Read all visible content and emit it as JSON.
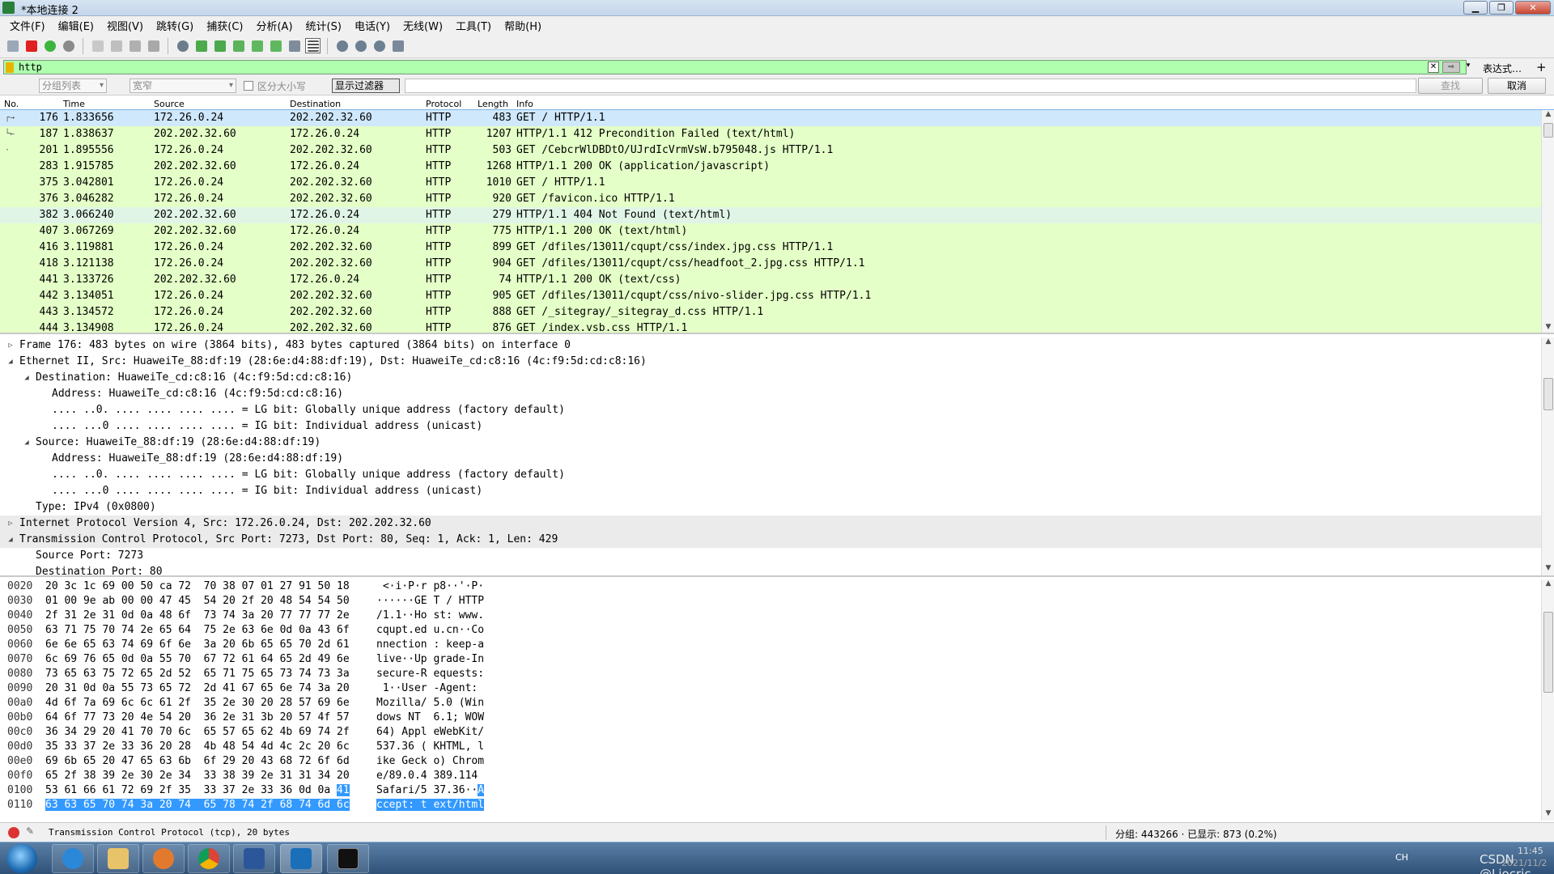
{
  "window": {
    "title": "*本地连接 2"
  },
  "menu": [
    "文件(F)",
    "编辑(E)",
    "视图(V)",
    "跳转(G)",
    "捕获(C)",
    "分析(A)",
    "统计(S)",
    "电话(Y)",
    "无线(W)",
    "工具(T)",
    "帮助(H)"
  ],
  "filter": {
    "value": "http",
    "expression_label": "表达式…",
    "clear_label": "✕",
    "plus_label": "+"
  },
  "find": {
    "packet_list_combo": "分组列表",
    "width_combo": "宽窄",
    "case_label": "区分大小写",
    "display_filter_btn": "显示过滤器",
    "find_btn": "查找",
    "cancel_btn": "取消"
  },
  "packet_list": {
    "columns": {
      "no": "No.",
      "time": "Time",
      "source": "Source",
      "destination": "Destination",
      "protocol": "Protocol",
      "length": "Length",
      "info": "Info"
    },
    "rows": [
      {
        "no": "176",
        "time": "1.833656",
        "src": "172.26.0.24",
        "dst": "202.202.32.60",
        "proto": "HTTP",
        "len": "483",
        "info": "GET / HTTP/1.1"
      },
      {
        "no": "187",
        "time": "1.838637",
        "src": "202.202.32.60",
        "dst": "172.26.0.24",
        "proto": "HTTP",
        "len": "1207",
        "info": "HTTP/1.1 412 Precondition Failed  (text/html)"
      },
      {
        "no": "201",
        "time": "1.895556",
        "src": "172.26.0.24",
        "dst": "202.202.32.60",
        "proto": "HTTP",
        "len": "503",
        "info": "GET /CebcrWlDBDtO/UJrdIcVrmVsW.b795048.js HTTP/1.1"
      },
      {
        "no": "283",
        "time": "1.915785",
        "src": "202.202.32.60",
        "dst": "172.26.0.24",
        "proto": "HTTP",
        "len": "1268",
        "info": "HTTP/1.1 200 OK  (application/javascript)"
      },
      {
        "no": "375",
        "time": "3.042801",
        "src": "172.26.0.24",
        "dst": "202.202.32.60",
        "proto": "HTTP",
        "len": "1010",
        "info": "GET / HTTP/1.1"
      },
      {
        "no": "376",
        "time": "3.046282",
        "src": "172.26.0.24",
        "dst": "202.202.32.60",
        "proto": "HTTP",
        "len": "920",
        "info": "GET /favicon.ico HTTP/1.1"
      },
      {
        "no": "382",
        "time": "3.066240",
        "src": "202.202.32.60",
        "dst": "172.26.0.24",
        "proto": "HTTP",
        "len": "279",
        "info": "HTTP/1.1 404 Not Found  (text/html)"
      },
      {
        "no": "407",
        "time": "3.067269",
        "src": "202.202.32.60",
        "dst": "172.26.0.24",
        "proto": "HTTP",
        "len": "775",
        "info": "HTTP/1.1 200 OK  (text/html)"
      },
      {
        "no": "416",
        "time": "3.119881",
        "src": "172.26.0.24",
        "dst": "202.202.32.60",
        "proto": "HTTP",
        "len": "899",
        "info": "GET /dfiles/13011/cqupt/css/index.jpg.css HTTP/1.1"
      },
      {
        "no": "418",
        "time": "3.121138",
        "src": "172.26.0.24",
        "dst": "202.202.32.60",
        "proto": "HTTP",
        "len": "904",
        "info": "GET /dfiles/13011/cqupt/css/headfoot_2.jpg.css HTTP/1.1"
      },
      {
        "no": "441",
        "time": "3.133726",
        "src": "202.202.32.60",
        "dst": "172.26.0.24",
        "proto": "HTTP",
        "len": "74",
        "info": "HTTP/1.1 200 OK  (text/css)"
      },
      {
        "no": "442",
        "time": "3.134051",
        "src": "172.26.0.24",
        "dst": "202.202.32.60",
        "proto": "HTTP",
        "len": "905",
        "info": "GET /dfiles/13011/cqupt/css/nivo-slider.jpg.css HTTP/1.1"
      },
      {
        "no": "443",
        "time": "3.134572",
        "src": "172.26.0.24",
        "dst": "202.202.32.60",
        "proto": "HTTP",
        "len": "888",
        "info": "GET /_sitegray/_sitegray_d.css HTTP/1.1"
      },
      {
        "no": "444",
        "time": "3.134908",
        "src": "172.26.0.24",
        "dst": "202.202.32.60",
        "proto": "HTTP",
        "len": "876",
        "info": "GET /index.vsb.css HTTP/1.1"
      }
    ]
  },
  "detail_tree": [
    {
      "toggle": "▷",
      "text": "Frame 176: 483 bytes on wire (3864 bits), 483 bytes captured (3864 bits) on interface 0"
    },
    {
      "toggle": "◢",
      "text": "Ethernet II, Src: HuaweiTe_88:df:19 (28:6e:d4:88:df:19), Dst: HuaweiTe_cd:c8:16 (4c:f9:5d:cd:c8:16)"
    },
    {
      "toggle": "◢",
      "text": "Destination: HuaweiTe_cd:c8:16 (4c:f9:5d:cd:c8:16)"
    },
    {
      "toggle": "",
      "text": "Address: HuaweiTe_cd:c8:16 (4c:f9:5d:cd:c8:16)"
    },
    {
      "toggle": "",
      "text": ".... ..0. .... .... .... .... = LG bit: Globally unique address (factory default)"
    },
    {
      "toggle": "",
      "text": ".... ...0 .... .... .... .... = IG bit: Individual address (unicast)"
    },
    {
      "toggle": "◢",
      "text": "Source: HuaweiTe_88:df:19 (28:6e:d4:88:df:19)"
    },
    {
      "toggle": "",
      "text": "Address: HuaweiTe_88:df:19 (28:6e:d4:88:df:19)"
    },
    {
      "toggle": "",
      "text": ".... ..0. .... .... .... .... = LG bit: Globally unique address (factory default)"
    },
    {
      "toggle": "",
      "text": ".... ...0 .... .... .... .... = IG bit: Individual address (unicast)"
    },
    {
      "toggle": "",
      "text": "Type: IPv4 (0x0800)"
    },
    {
      "toggle": "▷",
      "text": "Internet Protocol Version 4, Src: 172.26.0.24, Dst: 202.202.32.60"
    },
    {
      "toggle": "◢",
      "text": "Transmission Control Protocol, Src Port: 7273, Dst Port: 80, Seq: 1, Ack: 1, Len: 429"
    },
    {
      "toggle": "",
      "text": "Source Port: 7273"
    },
    {
      "toggle": "",
      "text": "Destination Port: 80"
    }
  ],
  "hex_dump": [
    {
      "off": "0020",
      "bytes": "20 3c 1c 69 00 50 ca 72  70 38 07 01 27 91 50 18",
      "sel_bytes": "",
      "ascii": " <·i·P·r p8··'·P·",
      "sel_ascii": ""
    },
    {
      "off": "0030",
      "bytes": "01 00 9e ab 00 00 47 45  54 20 2f 20 48 54 54 50",
      "sel_bytes": "",
      "ascii": "······GE T / HTTP",
      "sel_ascii": ""
    },
    {
      "off": "0040",
      "bytes": "2f 31 2e 31 0d 0a 48 6f  73 74 3a 20 77 77 77 2e",
      "sel_bytes": "",
      "ascii": "/1.1··Ho st: www.",
      "sel_ascii": ""
    },
    {
      "off": "0050",
      "bytes": "63 71 75 70 74 2e 65 64  75 2e 63 6e 0d 0a 43 6f",
      "sel_bytes": "",
      "ascii": "cqupt.ed u.cn··Co",
      "sel_ascii": ""
    },
    {
      "off": "0060",
      "bytes": "6e 6e 65 63 74 69 6f 6e  3a 20 6b 65 65 70 2d 61",
      "sel_bytes": "",
      "ascii": "nnection : keep-a",
      "sel_ascii": ""
    },
    {
      "off": "0070",
      "bytes": "6c 69 76 65 0d 0a 55 70  67 72 61 64 65 2d 49 6e",
      "sel_bytes": "",
      "ascii": "live··Up grade-In",
      "sel_ascii": ""
    },
    {
      "off": "0080",
      "bytes": "73 65 63 75 72 65 2d 52  65 71 75 65 73 74 73 3a",
      "sel_bytes": "",
      "ascii": "secure-R equests:",
      "sel_ascii": ""
    },
    {
      "off": "0090",
      "bytes": "20 31 0d 0a 55 73 65 72  2d 41 67 65 6e 74 3a 20",
      "sel_bytes": "",
      "ascii": " 1··User -Agent: ",
      "sel_ascii": ""
    },
    {
      "off": "00a0",
      "bytes": "4d 6f 7a 69 6c 6c 61 2f  35 2e 30 20 28 57 69 6e",
      "sel_bytes": "",
      "ascii": "Mozilla/ 5.0 (Win",
      "sel_ascii": ""
    },
    {
      "off": "00b0",
      "bytes": "64 6f 77 73 20 4e 54 20  36 2e 31 3b 20 57 4f 57",
      "sel_bytes": "",
      "ascii": "dows NT  6.1; WOW",
      "sel_ascii": ""
    },
    {
      "off": "00c0",
      "bytes": "36 34 29 20 41 70 70 6c  65 57 65 62 4b 69 74 2f",
      "sel_bytes": "",
      "ascii": "64) Appl eWebKit/",
      "sel_ascii": ""
    },
    {
      "off": "00d0",
      "bytes": "35 33 37 2e 33 36 20 28  4b 48 54 4d 4c 2c 20 6c",
      "sel_bytes": "",
      "ascii": "537.36 ( KHTML, l",
      "sel_ascii": ""
    },
    {
      "off": "00e0",
      "bytes": "69 6b 65 20 47 65 63 6b  6f 29 20 43 68 72 6f 6d",
      "sel_bytes": "",
      "ascii": "ike Geck o) Chrom",
      "sel_ascii": ""
    },
    {
      "off": "00f0",
      "bytes": "65 2f 38 39 2e 30 2e 34  33 38 39 2e 31 31 34 20",
      "sel_bytes": "",
      "ascii": "e/89.0.4 389.114 ",
      "sel_ascii": ""
    },
    {
      "off": "0100",
      "bytes": "53 61 66 61 72 69 2f 35  33 37 2e 33 36 0d 0a ",
      "sel_bytes": "41",
      "ascii": "Safari/5 37.36··",
      "sel_ascii": "A"
    },
    {
      "off": "0110",
      "bytes": "",
      "sel_bytes": "63 63 65 70 74 3a 20 74  65 78 74 2f 68 74 6d 6c",
      "ascii": "",
      "sel_ascii": "ccept: t ext/html"
    }
  ],
  "status": {
    "message": "Transmission Control Protocol (tcp), 20 bytes",
    "stats": "分组: 443266 · 已显示: 873 (0.2%)"
  },
  "taskbar": {
    "lang": "CH",
    "watermark": "CSDN @Liocric",
    "time": "11:45",
    "date": "2021/11/2"
  },
  "colors": {
    "http_row": "#e4ffc7",
    "selected_row": "#cfe8fc",
    "filter_ok": "#afffaf",
    "hex_selection": "#3399ff"
  }
}
